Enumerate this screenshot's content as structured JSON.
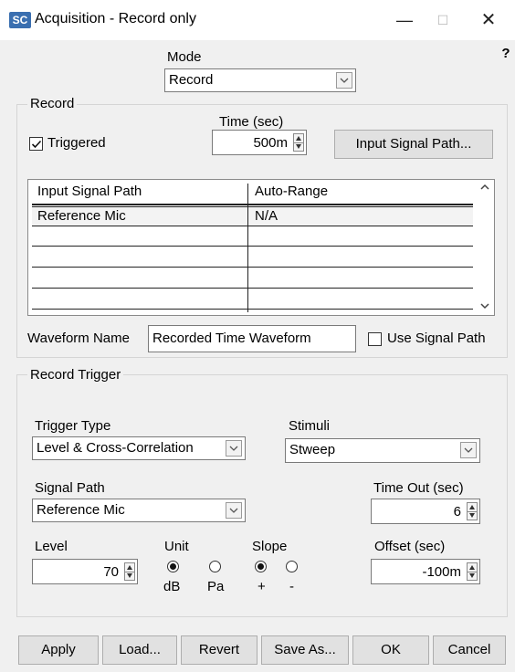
{
  "window": {
    "title": "Acquisition  - Record only",
    "logo_text": "SC"
  },
  "mode": {
    "label": "Mode",
    "value": "Record"
  },
  "record": {
    "group_label": "Record",
    "time_label": "Time (sec)",
    "time_value": "500m",
    "triggered_label": "Triggered",
    "triggered_checked": true,
    "input_signal_path_button": "Input Signal Path...",
    "table": {
      "columns": [
        "Input Signal Path",
        "Auto-Range"
      ],
      "rows": [
        [
          "Reference Mic",
          "N/A"
        ],
        [
          "",
          ""
        ],
        [
          "",
          ""
        ],
        [
          "",
          ""
        ],
        [
          "",
          ""
        ]
      ]
    },
    "waveform_name_label": "Waveform Name",
    "waveform_name_value": "Recorded Time Waveform",
    "use_signal_path_label": "Use Signal Path",
    "use_signal_path_checked": false
  },
  "record_trigger": {
    "group_label": "Record Trigger",
    "trigger_type_label": "Trigger Type",
    "trigger_type_value": "Level & Cross-Correlation",
    "stimuli_label": "Stimuli",
    "stimuli_value": "Stweep",
    "signal_path_label": "Signal Path",
    "signal_path_value": "Reference Mic",
    "time_out_label": "Time Out (sec)",
    "time_out_value": "6",
    "level_label": "Level",
    "level_value": "70",
    "unit_label": "Unit",
    "unit_options": [
      "dB",
      "Pa"
    ],
    "unit_selected": "dB",
    "slope_label": "Slope",
    "slope_options": [
      "+",
      "-"
    ],
    "slope_selected": "+",
    "offset_label": "Offset (sec)",
    "offset_value": "-100m"
  },
  "buttons": {
    "apply": "Apply",
    "load": "Load...",
    "revert": "Revert",
    "save_as": "Save As...",
    "ok": "OK",
    "cancel": "Cancel"
  }
}
